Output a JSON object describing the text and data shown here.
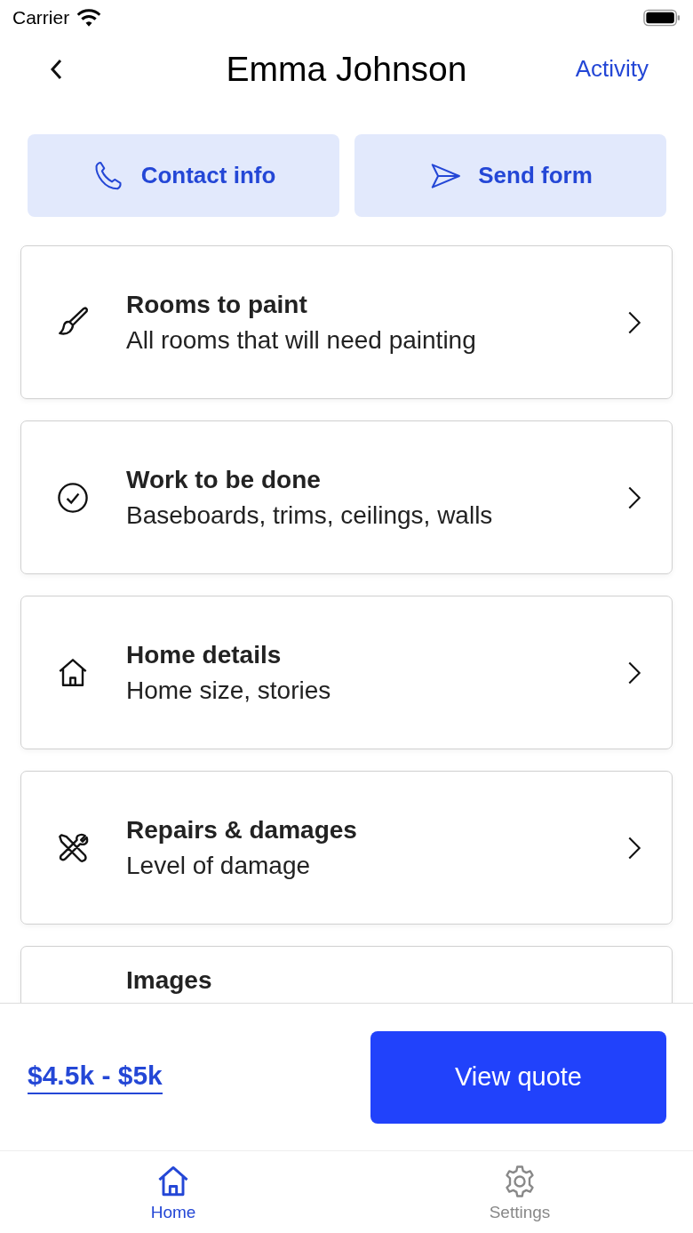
{
  "status_bar": {
    "carrier": "Carrier"
  },
  "nav": {
    "title": "Emma Johnson",
    "action": "Activity"
  },
  "actions": [
    {
      "kind": "phone",
      "label": "Contact info"
    },
    {
      "kind": "send",
      "label": "Send form"
    }
  ],
  "cards": [
    {
      "kind": "brush",
      "title": "Rooms to paint",
      "subtitle": "All rooms that will need painting"
    },
    {
      "kind": "check",
      "title": "Work to be done",
      "subtitle": "Baseboards, trims, ceilings, walls"
    },
    {
      "kind": "house",
      "title": "Home details",
      "subtitle": "Home size, stories"
    },
    {
      "kind": "tools",
      "title": "Repairs & damages",
      "subtitle": "Level of damage"
    },
    {
      "kind": "partial",
      "title": "Images"
    }
  ],
  "footer": {
    "price": "$4.5k - $5k",
    "button": "View quote"
  },
  "tabs": [
    {
      "kind": "home",
      "label": "Home",
      "selected": true
    },
    {
      "kind": "settings",
      "label": "Settings",
      "selected": false
    }
  ]
}
